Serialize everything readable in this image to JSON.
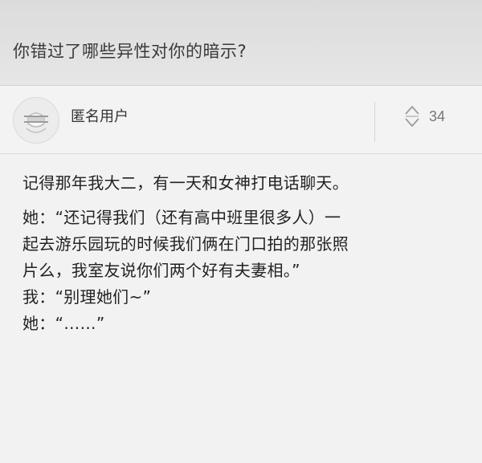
{
  "question": {
    "title": "你错过了哪些异性对你的暗示?"
  },
  "answer": {
    "author_name": "匿名用户",
    "vote_count": "34",
    "vote_icon": "up-down-vote-icon",
    "avatar_icon": "anonymous-avatar-icon",
    "paragraph_1": "记得那年我大二，有一天和女神打电话聊天。",
    "dialogue_line_1": "她：“还记得我们（还有高中班里很多人）一",
    "dialogue_line_2": "起去游乐园玩的时候我们俩在门口拍的那张照",
    "dialogue_line_3": "片么，我室友说你们两个好有夫妻相。”",
    "dialogue_line_4": "我：“别理她们~”",
    "dialogue_line_5": "她：“……”"
  }
}
